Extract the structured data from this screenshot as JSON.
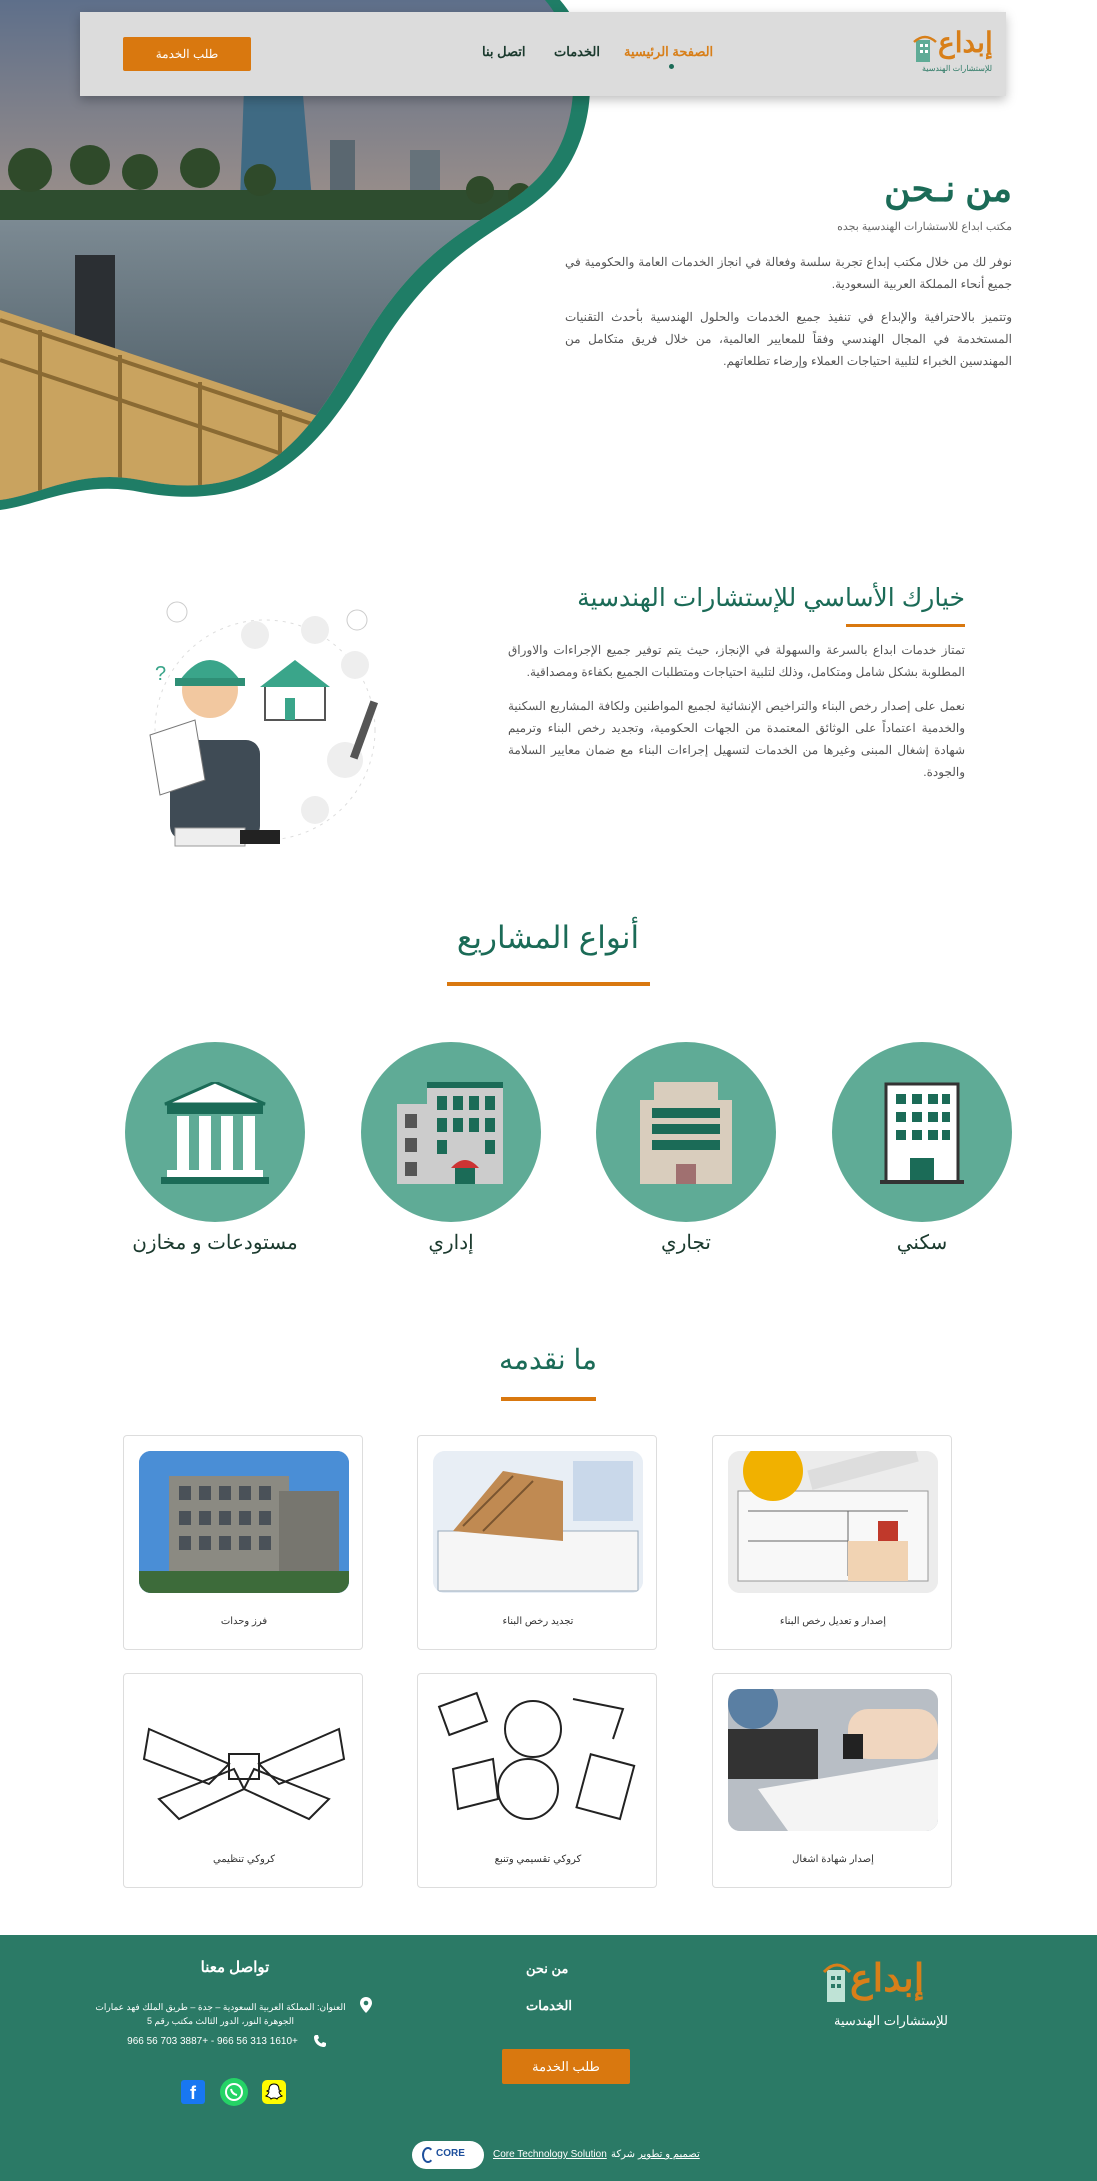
{
  "brand": {
    "name": "إبداع",
    "subtitle": "للإستشارات الهندسية"
  },
  "nav": {
    "items": [
      "الصفحة الرئيسية",
      "الخدمات",
      "اتصل بنا"
    ],
    "active_index": 0,
    "cta": "طلب الخدمة"
  },
  "about": {
    "title": "من نـحن",
    "subtitle": "مكتب ابداع للاستشارات الهندسية بجده",
    "para1": "نوفر لك من خلال مكتب إبداع تجربة سلسة وفعالة في انجاز الخدمات العامة والحكومية في جميع أنحاء المملكة العربية السعودية.",
    "para2": "وتتميز بالاحترافية والإبداع في تنفيذ جميع الخدمات والحلول الهندسية بأحدث التقنيات المستخدمة في المجال الهندسي وفقاً للمعايير العالمية، من خلال فريق متكامل من المهندسين الخبراء لتلبية احتياجات العملاء وإرضاء تطلعاتهم."
  },
  "choice": {
    "title": "خيارك الأساسي للإستشارات الهندسية",
    "para1": "تمتاز خدمات ابداع بالسرعة والسهولة في الإنجاز، حيث يتم توفير جميع الإجراءات والاوراق المطلوبة بشكل شامل ومتكامل، وذلك لتلبية احتياجات ومتطلبات الجميع بكفاءة ومصداقية.",
    "para2": "نعمل على إصدار رخص البناء والتراخيص الإنشائية لجميع المواطنين ولكافة المشاريع السكنية والخدمية اعتماداً على الوثائق المعتمدة من الجهات الحكومية، وتجديد رخص البناء وترميم شهادة إشغال المبنى وغيرها من الخدمات لتسهيل إجراءات البناء مع ضمان معايير السلامة والجودة."
  },
  "projects": {
    "title": "أنواع المشاريع",
    "types": [
      "سكني",
      "تجاري",
      "إداري",
      "مستودعات و مخازن"
    ]
  },
  "services": {
    "title": "ما نقدمه",
    "items": [
      "إصدار و تعديل رخص البناء",
      "تجديد رخص البناء",
      "فرز وحدات",
      "إصدار شهادة اشغال",
      "كروكي تقسيمي وتنبع",
      "كروكي تنظيمي"
    ]
  },
  "footer": {
    "contact_title": "تواصل معنا",
    "address": "العنوان: المملكة العربية السعودية – جدة – طريق الملك فهد عمارات الجوهرة النور، الدور الثالث مكتب رقم 5",
    "phones": "966 56 703 3887+ - 966 56 313 1610+",
    "links": [
      "من نحن",
      "الخدمات"
    ],
    "cta": "طلب الخدمة",
    "credit_prefix": "تصميم و تطوير",
    "credit_company_word": "شركة",
    "credit_company": "Core Technology Solution",
    "credit_logo": "CORE"
  },
  "colors": {
    "primary": "#2b7a66",
    "accent": "#d9780f",
    "circle": "#5fab96",
    "dark": "#1b3a2e"
  },
  "icons": [
    "location-icon",
    "phone-icon",
    "facebook-icon",
    "whatsapp-icon",
    "snapchat-icon"
  ]
}
